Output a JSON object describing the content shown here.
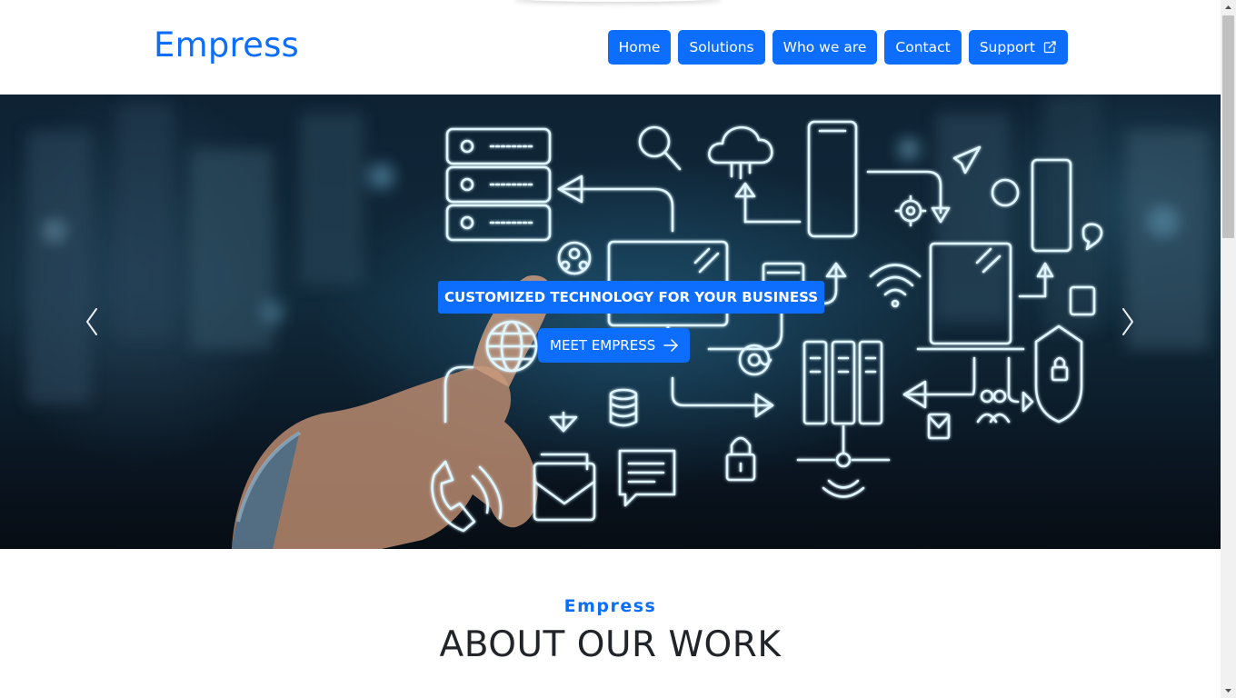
{
  "header": {
    "brand": "Empress",
    "nav": [
      {
        "label": "Home"
      },
      {
        "label": "Solutions"
      },
      {
        "label": "Who we are"
      },
      {
        "label": "Contact"
      },
      {
        "label": "Support",
        "icon": "external-link-icon"
      }
    ]
  },
  "hero": {
    "caption": "CUSTOMIZED TECHNOLOGY FOR YOUR BUSINESS",
    "cta_label": "MEET EMPRESS",
    "cta_icon": "arrow-right-icon",
    "prev_icon": "chevron-left-icon",
    "next_icon": "chevron-right-icon"
  },
  "about": {
    "kicker": "Empress",
    "title": "ABOUT OUR WORK"
  },
  "colors": {
    "primary": "#0d6efd",
    "heading": "#212529",
    "hero_line": "#dff6ff"
  }
}
